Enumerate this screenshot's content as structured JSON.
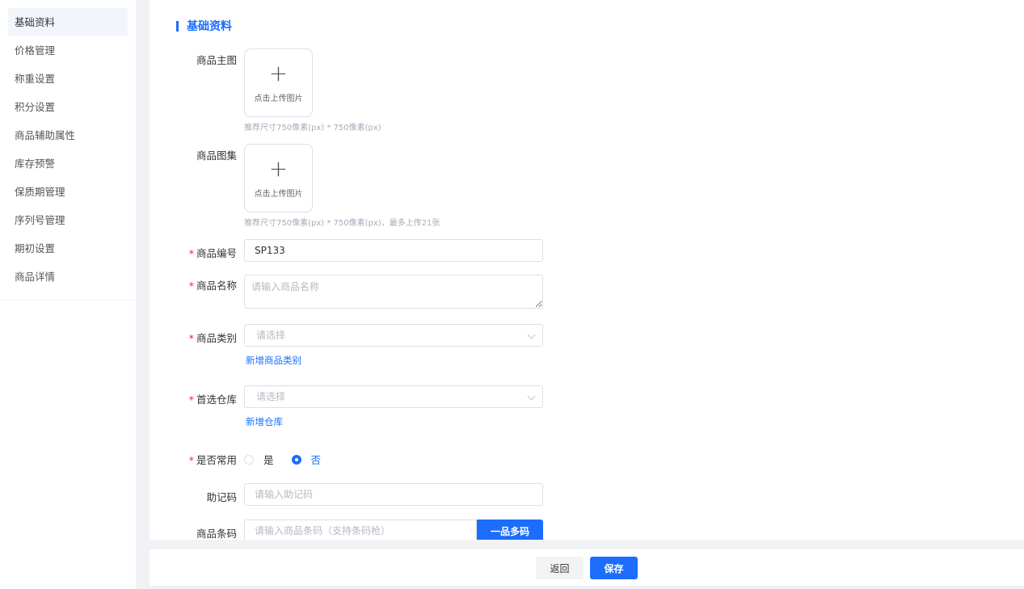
{
  "sidebar": {
    "items": [
      {
        "label": "基础资料",
        "active": true
      },
      {
        "label": "价格管理"
      },
      {
        "label": "称重设置"
      },
      {
        "label": "积分设置"
      },
      {
        "label": "商品辅助属性"
      },
      {
        "label": "库存预警"
      },
      {
        "label": "保质期管理"
      },
      {
        "label": "序列号管理"
      },
      {
        "label": "期初设置"
      },
      {
        "label": "商品详情"
      }
    ]
  },
  "form": {
    "section_title": "基础资料",
    "main_image": {
      "label": "商品主图",
      "upload_text": "点击上传图片",
      "hint": "推荐尺寸750像素(px) * 750像素(px)"
    },
    "gallery": {
      "label": "商品图集",
      "upload_text": "点击上传图片",
      "hint": "推荐尺寸750像素(px) * 750像素(px)，最多上传21张"
    },
    "code": {
      "label": "商品编号",
      "value": "SP133"
    },
    "name": {
      "label": "商品名称",
      "placeholder": "请输入商品名称"
    },
    "category": {
      "label": "商品类别",
      "placeholder": "请选择",
      "add_link": "新增商品类别"
    },
    "warehouse": {
      "label": "首选仓库",
      "placeholder": "请选择",
      "add_link": "新增仓库"
    },
    "common": {
      "label": "是否常用",
      "options": [
        "是",
        "否"
      ],
      "selected": "否"
    },
    "mnemonic": {
      "label": "助记码",
      "placeholder": "请输入助记码"
    },
    "barcode": {
      "label": "商品条码",
      "placeholder": "请输入商品条码（支持条码枪）",
      "button": "一品多码"
    }
  },
  "footer": {
    "back": "返回",
    "save": "保存"
  },
  "colors": {
    "accent": "#1c6dfc",
    "required": "#f5222d"
  }
}
